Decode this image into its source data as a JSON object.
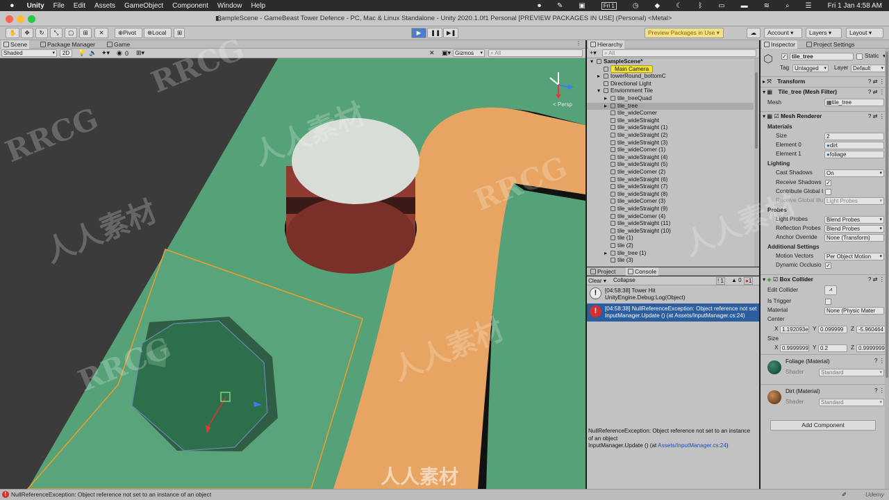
{
  "macbar": {
    "app": "Unity",
    "menus": [
      "File",
      "Edit",
      "Assets",
      "GameObject",
      "Component",
      "Window",
      "Help"
    ],
    "fri_label": "Fri 1",
    "datetime": "Fri 1 Jan 4:58 AM"
  },
  "window": {
    "title": "SampleScene - GameBeast Tower Defence - PC, Mac & Linux Standalone - Unity 2020.1.0f1 Personal [PREVIEW PACKAGES IN USE] (Personal) <Metal>"
  },
  "toolbar": {
    "pivot": "Pivot",
    "local": "Local",
    "preview_packages": "Preview Packages in Use",
    "account": "Account",
    "layers": "Layers",
    "layout": "Layout"
  },
  "tabs": {
    "scene": "Scene",
    "package_manager": "Package Manager",
    "game": "Game",
    "hierarchy": "Hierarchy",
    "inspector": "Inspector",
    "project_settings": "Project Settings",
    "project": "Project",
    "console": "Console"
  },
  "scene_toolbar": {
    "shading": "Shaded",
    "mode_2d": "2D",
    "hidden_count": "0",
    "gizmos": "Gizmos",
    "search_placeholder": "All",
    "persp": "< Persp"
  },
  "hierarchy": {
    "search_placeholder": "All",
    "items": [
      {
        "label": "SampleScene*",
        "indent": 0,
        "bold": true,
        "arrow": "▾"
      },
      {
        "label": "Main Camera",
        "indent": 1,
        "highlight": true,
        "arrow": ""
      },
      {
        "label": "towerRound_bottomC",
        "indent": 1,
        "arrow": "▸"
      },
      {
        "label": "Directional Light",
        "indent": 1,
        "arrow": ""
      },
      {
        "label": "Enviornment Tile",
        "indent": 1,
        "arrow": "▾"
      },
      {
        "label": "tile_treeQuad",
        "indent": 2,
        "arrow": "▸"
      },
      {
        "label": "tile_tree",
        "indent": 2,
        "selected": true,
        "arrow": "▸"
      },
      {
        "label": "tile_wideCorner",
        "indent": 2,
        "arrow": ""
      },
      {
        "label": "tile_wideStraight",
        "indent": 2,
        "arrow": ""
      },
      {
        "label": "tile_wideStraight (1)",
        "indent": 2,
        "arrow": ""
      },
      {
        "label": "tile_wideStraight (2)",
        "indent": 2,
        "arrow": ""
      },
      {
        "label": "tile_wideStraight (3)",
        "indent": 2,
        "arrow": ""
      },
      {
        "label": "tile_wideCorner (1)",
        "indent": 2,
        "arrow": ""
      },
      {
        "label": "tile_wideStraight (4)",
        "indent": 2,
        "arrow": ""
      },
      {
        "label": "tile_wideStraight (5)",
        "indent": 2,
        "arrow": ""
      },
      {
        "label": "tile_wideCorner (2)",
        "indent": 2,
        "arrow": ""
      },
      {
        "label": "tile_wideStraight (6)",
        "indent": 2,
        "arrow": ""
      },
      {
        "label": "tile_wideStraight (7)",
        "indent": 2,
        "arrow": ""
      },
      {
        "label": "tile_wideStraight (8)",
        "indent": 2,
        "arrow": ""
      },
      {
        "label": "tile_wideCorner (3)",
        "indent": 2,
        "arrow": ""
      },
      {
        "label": "tile_wideStraight (9)",
        "indent": 2,
        "arrow": ""
      },
      {
        "label": "tile_wideCorner (4)",
        "indent": 2,
        "arrow": ""
      },
      {
        "label": "tile_wideStraight (11)",
        "indent": 2,
        "arrow": ""
      },
      {
        "label": "tile_wideStraight (10)",
        "indent": 2,
        "arrow": ""
      },
      {
        "label": "tile (1)",
        "indent": 2,
        "arrow": ""
      },
      {
        "label": "tile (2)",
        "indent": 2,
        "arrow": ""
      },
      {
        "label": "tile_tree (1)",
        "indent": 2,
        "arrow": "▸"
      },
      {
        "label": "tile (3)",
        "indent": 2,
        "arrow": ""
      }
    ]
  },
  "console": {
    "clear": "Clear",
    "collapse": "Collapse",
    "log_count": "1",
    "warn_count": "0",
    "error_count": "1",
    "entries": [
      {
        "line1": "[04:58:38] Tower Hit",
        "line2": "UnityEngine.Debug:Log(Object)",
        "type": "info"
      },
      {
        "line1": "[04:58:38] NullReferenceException: Object reference not set",
        "line2": "InputManager.Update () (at Assets/InputManager.cs:24)",
        "type": "error"
      }
    ],
    "detail_line1": "NullReferenceException: Object reference not set to an instance",
    "detail_line2": "of an object",
    "detail_line3": "InputManager.Update () (at ",
    "detail_link": "Assets/InputManager.cs:24",
    "detail_end": ")"
  },
  "inspector": {
    "object_name": "tile_tree",
    "static": "Static",
    "tag_label": "Tag",
    "tag_value": "Untagged",
    "layer_label": "Layer",
    "layer_value": "Default",
    "transform": "Transform",
    "mesh_filter": "Tile_tree (Mesh Filter)",
    "mesh_label": "Mesh",
    "mesh_value": "tile_tree",
    "mesh_renderer": "Mesh Renderer",
    "materials": "Materials",
    "size_label": "Size",
    "size_value": "2",
    "element0_label": "Element 0",
    "element0_value": "dirt",
    "element1_label": "Element 1",
    "element1_value": "foliage",
    "lighting": "Lighting",
    "cast_shadows_label": "Cast Shadows",
    "cast_shadows_value": "On",
    "receive_shadows_label": "Receive Shadows",
    "contribute_gi_label": "Contribute Global I",
    "receive_gi_label": "Receive Global Illu",
    "receive_gi_value": "Light Probes",
    "probes": "Probes",
    "light_probes_label": "Light Probes",
    "light_probes_value": "Blend Probes",
    "reflection_probes_label": "Reflection Probes",
    "reflection_probes_value": "Blend Probes",
    "anchor_override_label": "Anchor Override",
    "anchor_override_value": "None (Transform)",
    "additional_settings": "Additional Settings",
    "motion_vectors_label": "Motion Vectors",
    "motion_vectors_value": "Per Object Motion",
    "dynamic_occlusion_label": "Dynamic Occlusio",
    "box_collider": "Box Collider",
    "edit_collider_label": "Edit Collider",
    "is_trigger_label": "Is Trigger",
    "material_label": "Material",
    "material_value": "None (Physic Mater",
    "center_label": "Center",
    "center_x": "1.192093e",
    "center_y": "0.099999",
    "center_z": "-5.960464",
    "size2_label": "Size",
    "size_x": "0.9999999",
    "size_y": "0.2",
    "size_z": "0.9999999",
    "foliage_material": "Foliage (Material)",
    "dirt_material": "Dirt (Material)",
    "shader_label": "Shader",
    "shader_value": "Standard",
    "add_component": "Add Component"
  },
  "status": {
    "message": "NullReferenceException: Object reference not set to an instance of an object",
    "brand": "Udemy"
  },
  "watermarks": [
    "RRCG",
    "人人素材",
    "RRCG",
    "人人素材",
    "RRCG",
    "人人素材",
    "RRCG",
    "人人素材",
    "人人素材"
  ],
  "colors": {
    "grass": "#55a178",
    "path": "#e7a462",
    "selection": "#2c5d9e",
    "error": "#d32f2f"
  }
}
